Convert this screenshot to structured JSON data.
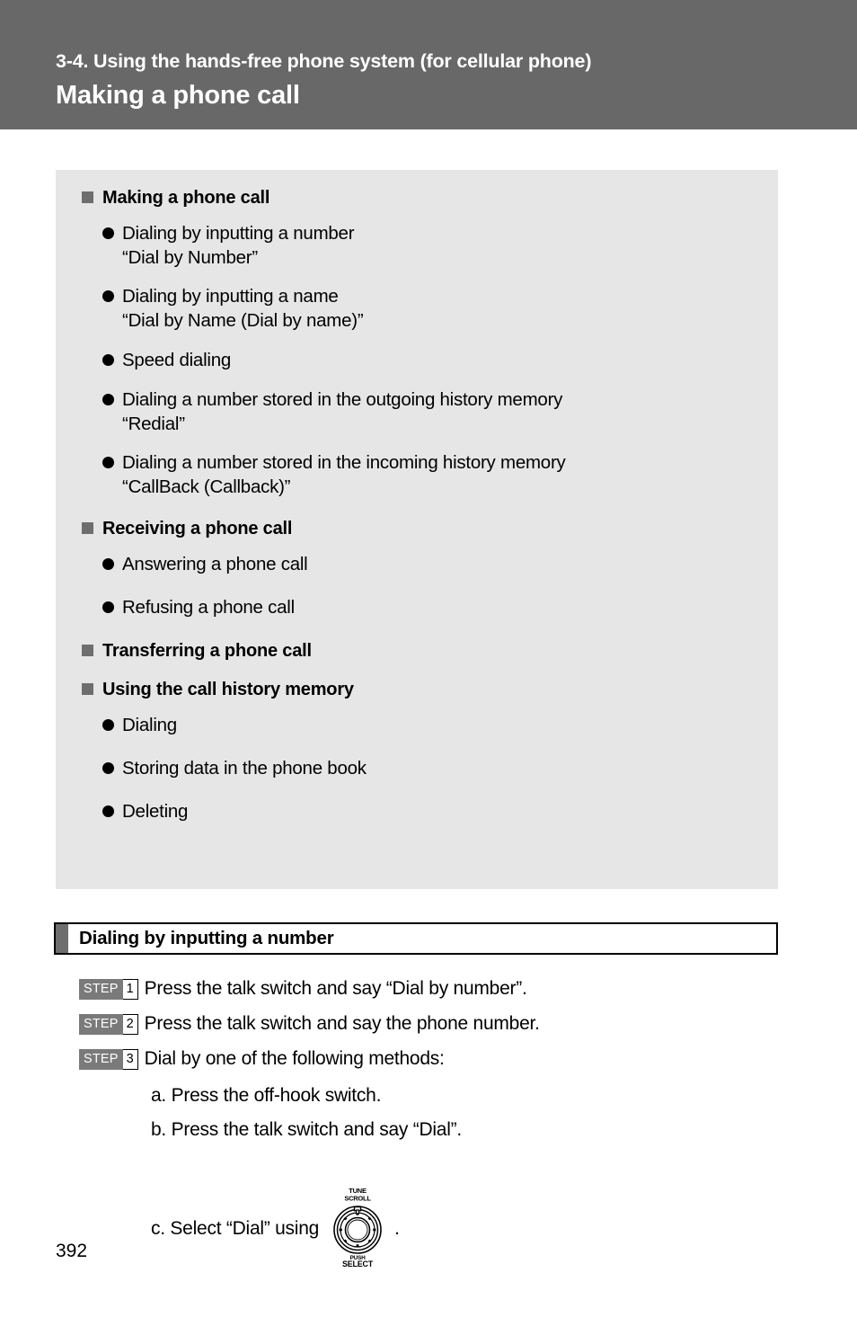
{
  "header": {
    "chapter": "3-4. Using the hands-free phone system (for cellular phone)",
    "title": "Making a phone call",
    "band_color": "#686868",
    "text_color": "#ffffff"
  },
  "overview": {
    "panel_color": "#e6e6e6",
    "square_bullet_color": "#6e6e6e",
    "dot_bullet_color": "#000000",
    "groups": [
      {
        "heading": "Making a phone call",
        "items": [
          {
            "text": "Dialing by inputting a number",
            "sub": "“Dial by Number”"
          },
          {
            "text": "Dialing by inputting a name",
            "sub": "“Dial by Name (Dial by name)”"
          },
          {
            "text": "Speed dialing",
            "sub": ""
          },
          {
            "text": "Dialing a number stored in the outgoing history memory",
            "sub": "“Redial”"
          },
          {
            "text": "Dialing a number stored in the incoming history memory",
            "sub": "“CallBack (Callback)”"
          }
        ]
      },
      {
        "heading": "Receiving a phone call",
        "items": [
          {
            "text": "Answering a phone call",
            "sub": ""
          },
          {
            "text": "Refusing a phone call",
            "sub": ""
          }
        ]
      },
      {
        "heading": "Transferring a phone call",
        "items": []
      },
      {
        "heading": "Using the call history memory",
        "items": [
          {
            "text": "Dialing",
            "sub": ""
          },
          {
            "text": "Storing data in the phone book",
            "sub": ""
          },
          {
            "text": "Deleting",
            "sub": ""
          }
        ]
      }
    ]
  },
  "section": {
    "title": "Dialing by inputting a number",
    "tab_color": "#6e6e6e"
  },
  "steps": {
    "badge_label": "STEP",
    "badge_color": "#7a7a7a",
    "items": [
      {
        "number": "1",
        "text": "Press the talk switch and say “Dial by number”."
      },
      {
        "number": "2",
        "text": "Press the talk switch and say the phone number."
      },
      {
        "number": "3",
        "text": "Dial by one of the following methods:"
      }
    ]
  },
  "substeps": {
    "a": "a. Press the off-hook switch.",
    "b": "b. Press the talk switch and say “Dial”.",
    "c_before": "c. Select “Dial” using",
    "c_after": "."
  },
  "knob": {
    "label_top_1": "TUNE",
    "label_top_2": "SCROLL",
    "label_bottom_1": "PUSH",
    "label_bottom_2": "SELECT"
  },
  "footer": {
    "page_number": "392"
  }
}
